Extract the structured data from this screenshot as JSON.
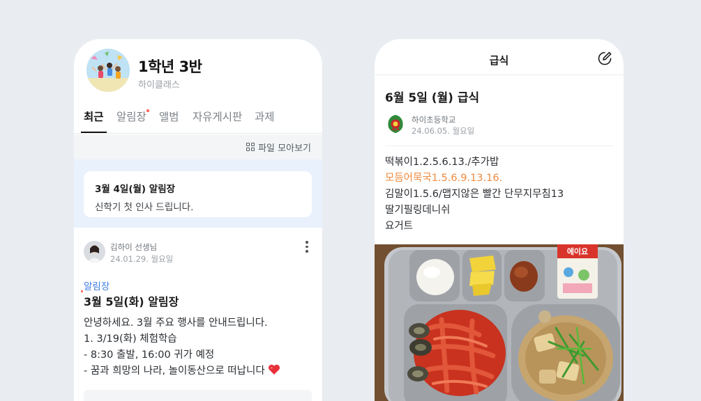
{
  "class_feed": {
    "class_name": "1학년 3반",
    "app_name": "하이클래스",
    "tabs": [
      {
        "label": "최근",
        "active": true
      },
      {
        "label": "알림장",
        "active": false,
        "has_new": true
      },
      {
        "label": "앨범",
        "active": false
      },
      {
        "label": "자유게시판",
        "active": false
      },
      {
        "label": "과제",
        "active": false
      }
    ],
    "file_link": "파일 모아보기",
    "notice": {
      "title": "3월 4일(월) 알림장",
      "body": "신학기 첫 인사 드립니다."
    },
    "post": {
      "author": "김하이 선생님",
      "date": "24.01.29. 월요일",
      "category": "알림장",
      "title": "3월 5일(화) 알림장",
      "lines": [
        "안녕하세요. 3월 주요 행사를 안내드립니다.",
        "1. 3/19(화) 체험학습",
        "- 8:30 출발, 16:00 귀가 예정",
        "- 꿈과 희망의 나라, 놀이동산으로 떠납니다"
      ],
      "emoji_icon": "red-heart"
    }
  },
  "meal": {
    "header_title": "급식",
    "title": "6월 5일 (월) 급식",
    "school": "하이초등학교",
    "date": "24.06.05. 월요일",
    "menu": [
      {
        "text": "떡볶이1.2.5.6.13./추가밥",
        "highlight": false
      },
      {
        "text": "모듬어묵국1.5.6.9.13.16.",
        "highlight": true
      },
      {
        "text": "김말이1.5.6/맵지않은 빨간 단무지무침13",
        "highlight": false
      },
      {
        "text": "딸기필링데니쉬",
        "highlight": false
      },
      {
        "text": "요거트",
        "highlight": false
      }
    ],
    "photo_label": "에이요",
    "colors": {
      "highlight": "#ef8a3e",
      "accent": "#3d7ce0",
      "new_dot": "#ff5a4f"
    }
  }
}
